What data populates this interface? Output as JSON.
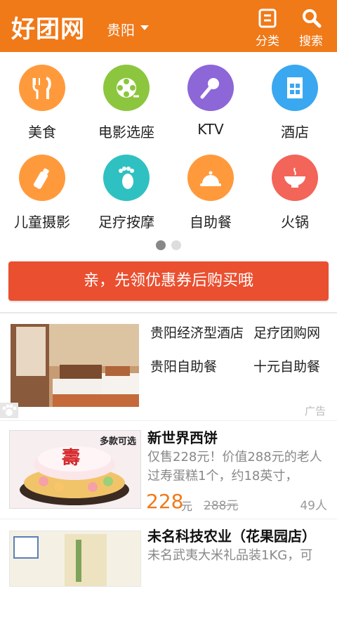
{
  "header": {
    "logo": "好团网",
    "city": "贵阳",
    "category_label": "分类",
    "search_label": "搜索",
    "color": "#f07918"
  },
  "categories": [
    {
      "label": "美食",
      "icon": "fork-knife-icon",
      "color": "#ff9a3c"
    },
    {
      "label": "电影选座",
      "icon": "film-reel-icon",
      "color": "#8cc63e"
    },
    {
      "label": "KTV",
      "icon": "microphone-icon",
      "color": "#8d66d8"
    },
    {
      "label": "酒店",
      "icon": "hotel-icon",
      "color": "#3aa8f0"
    },
    {
      "label": "儿童摄影",
      "icon": "baby-bottle-icon",
      "color": "#ff9a3c"
    },
    {
      "label": "足疗按摩",
      "icon": "foot-icon",
      "color": "#2fc1c1"
    },
    {
      "label": "自助餐",
      "icon": "dish-cover-icon",
      "color": "#ff9a3c"
    },
    {
      "label": "火锅",
      "icon": "hotpot-icon",
      "color": "#f36459"
    }
  ],
  "pager": {
    "active": 0,
    "count": 2
  },
  "promo": {
    "label": "亲，先领优惠券后购买哦",
    "color": "#ea4f30"
  },
  "ad": {
    "links": [
      "贵阳经济型酒店",
      "足疗团购网",
      "贵阳自助餐",
      "十元自助餐"
    ],
    "tag": "广告"
  },
  "deals": [
    {
      "title": "新世界西饼",
      "desc": "仅售228元！价值288元的老人过寿蛋糕1个，约18英寸，",
      "price": "228",
      "price_unit": "元",
      "original": "288元",
      "sold": "49人",
      "image_caption": "多款可选",
      "image_char": "壽"
    },
    {
      "title": "未名科技农业（花果园店）",
      "desc": "未名武夷大米礼品装1KG，可"
    }
  ]
}
